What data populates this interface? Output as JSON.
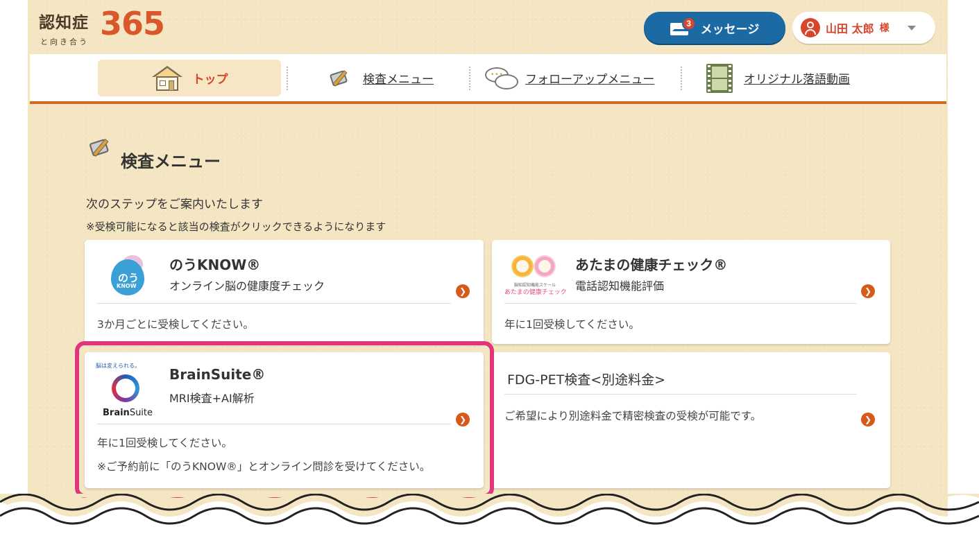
{
  "header": {
    "logo_main": "認知症",
    "logo_number": "365",
    "logo_sub": "と向き合う",
    "message_label": "メッセージ",
    "message_badge": "3",
    "user_name": "山田 太郎",
    "user_suffix": "様"
  },
  "nav": {
    "top": "トップ",
    "exam_menu": "検査メニュー",
    "followup_menu": "フォローアップメニュー",
    "rakugo_video": "オリジナル落語動画"
  },
  "section": {
    "title": "検査メニュー",
    "intro_line1": "次のステップをご案内いたします",
    "intro_line2": "※受検可能になると該当の検査がクリックできるようになります"
  },
  "cards": [
    {
      "title": "のうKNOW®",
      "subtitle": "オンライン脳の健康度チェック",
      "note": "3か月ごとに受検してください。",
      "logo_text_1": "のう",
      "logo_text_2": "KNOW"
    },
    {
      "title": "あたまの健康チェック®",
      "subtitle": "電話認知機能評価",
      "note": "年に1回受検してください。",
      "logo_text_1": "脳知認知機能スケール",
      "logo_text_2": "あたまの健康チェック"
    },
    {
      "title": "BrainSuite®",
      "subtitle": "MRI検査+AI解析",
      "note": "年に1回受検してください。",
      "note2": "※ご予約前に「のうKNOW®」とオンライン問診を受けてください。",
      "logo_tag": "脳は変えられる。",
      "logo_name_bold": "Brain",
      "logo_name_rest": "Suite"
    },
    {
      "title": "FDG-PET検査<別途料金>",
      "note": "ご希望により別途料金で精密検査の受検が可能です。"
    }
  ],
  "colors": {
    "accent_orange": "#d85a1a",
    "message_blue": "#1b6aa3",
    "highlight_pink": "#e0357a",
    "background": "#f5e6c3"
  }
}
